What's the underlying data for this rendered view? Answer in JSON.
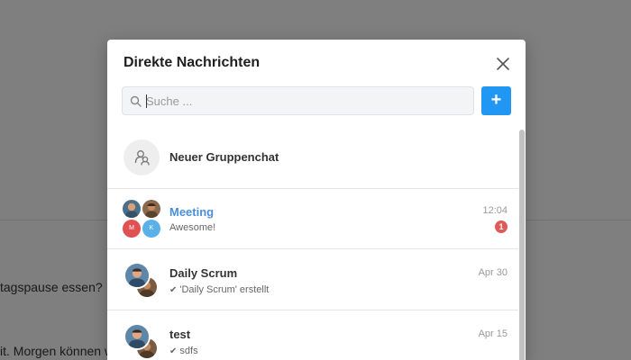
{
  "background": {
    "message_1": "tagspause essen?",
    "message_2": "it. Morgen können wir"
  },
  "modal": {
    "title": "Direkte Nachrichten",
    "close_icon": "close-icon",
    "search": {
      "placeholder": "Suche ...",
      "value": "",
      "icon": "search-icon"
    },
    "add_button_label": "+",
    "new_group": {
      "label": "Neuer Gruppenchat",
      "icon": "group-chat-icon"
    },
    "conversations": [
      {
        "name": "Meeting",
        "preview": "Awesome!",
        "time": "12:04",
        "unread": "1",
        "avatar_initials": [
          "M",
          "K"
        ],
        "name_color": "#4a90d9"
      },
      {
        "name": "Daily Scrum",
        "preview": "'Daily Scrum' erstellt",
        "time": "Apr 30",
        "read_icon": "check-icon"
      },
      {
        "name": "test",
        "preview": "sdfs",
        "time": "Apr 15",
        "read_icon": "check-icon"
      }
    ]
  },
  "colors": {
    "accent": "#2196f3",
    "unread_badge": "#e05a5a",
    "link_name": "#4a90d9",
    "overlay": "rgba(0,0,0,0.5)"
  }
}
